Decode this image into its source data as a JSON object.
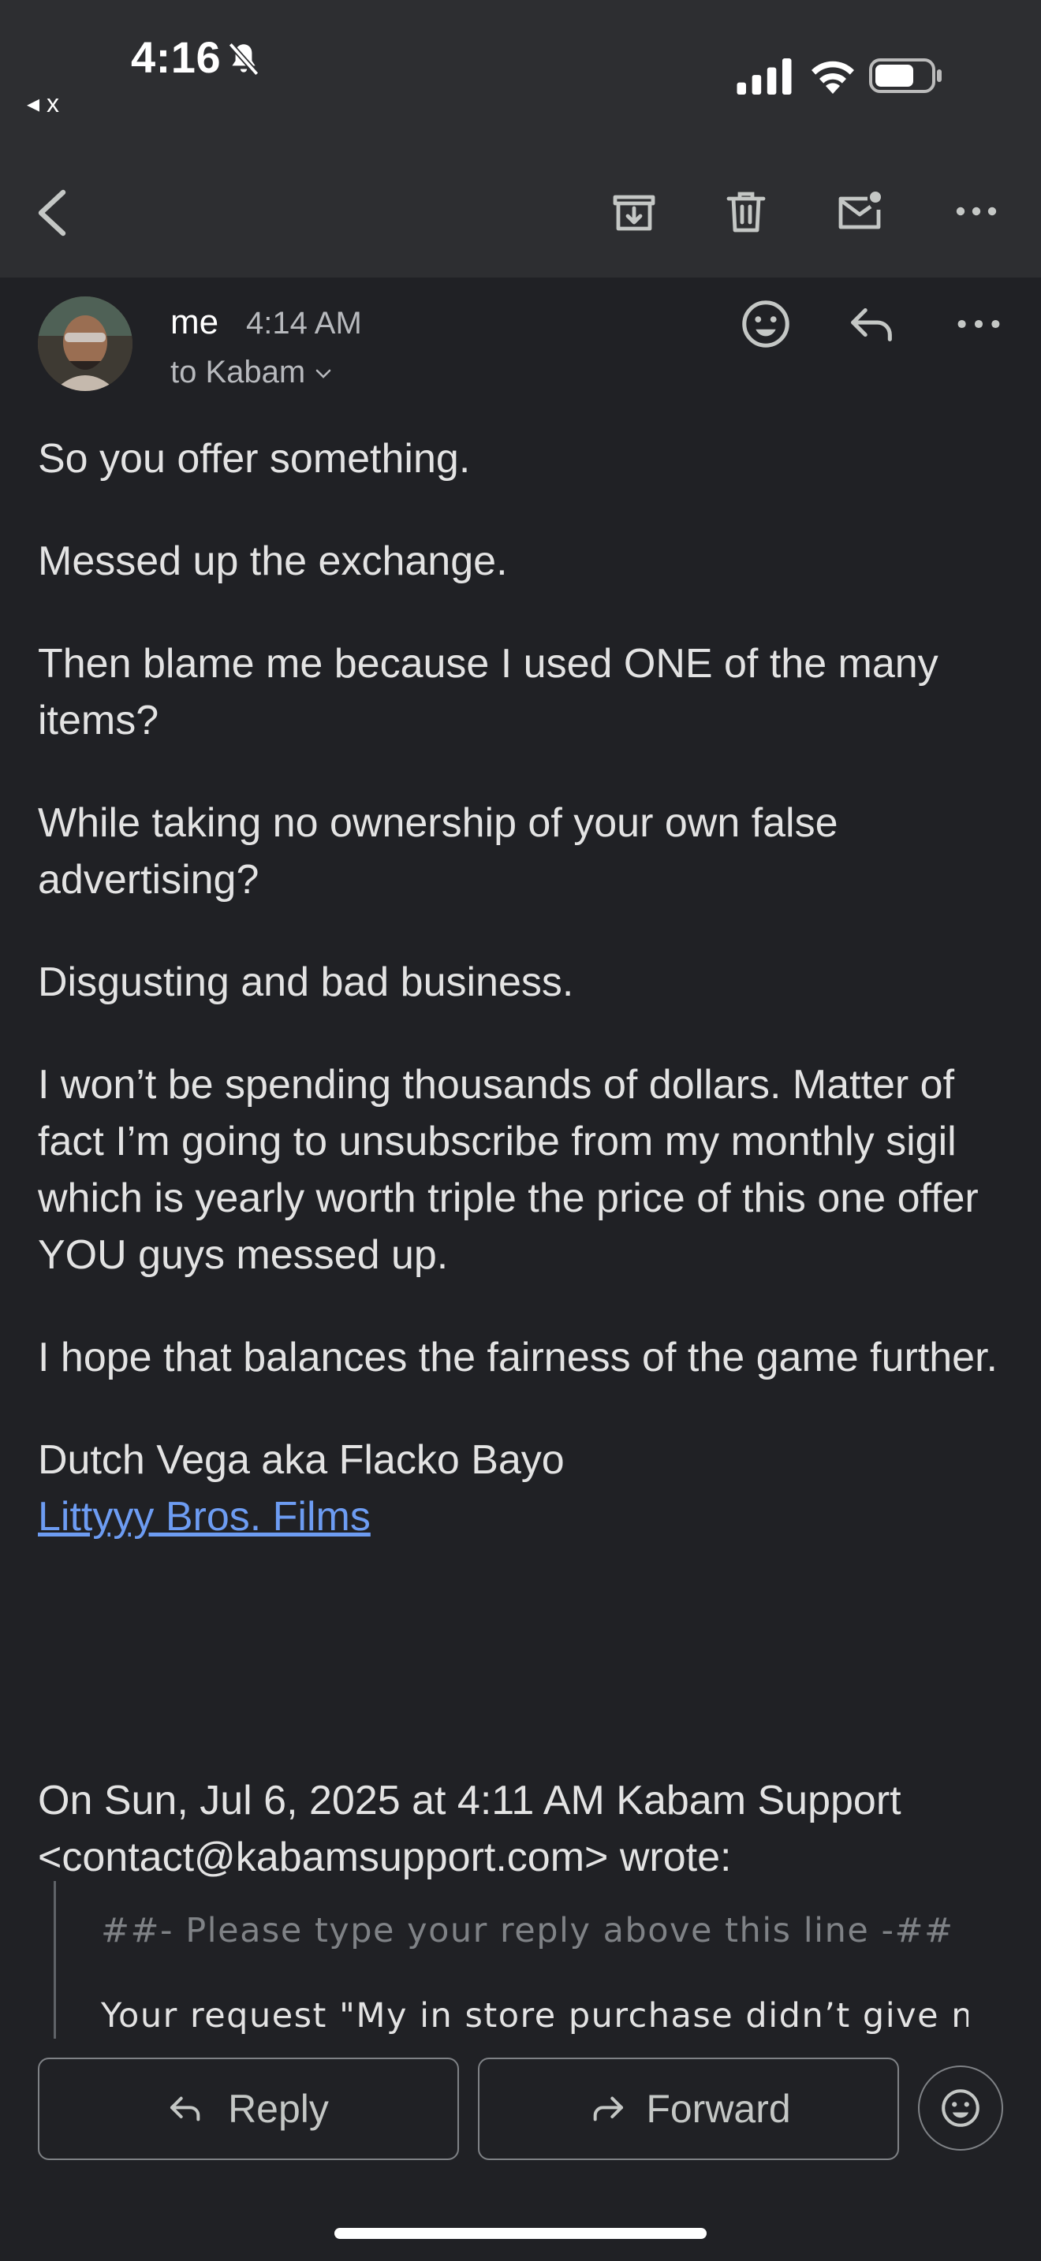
{
  "status_bar": {
    "time": "4:16",
    "back_app": "◂ x"
  },
  "toolbar": {
    "icons": [
      "back-arrow-icon",
      "archive-icon",
      "delete-icon",
      "mark-unread-icon",
      "more-icon"
    ]
  },
  "message": {
    "sender": "me",
    "time": "4:14 AM",
    "recipient": "to Kabam",
    "paragraphs": [
      "So you offer something.",
      "Messed up the exchange.",
      "Then blame me because I used ONE of the many items?",
      "While taking no ownership of your own false advertising?",
      "Disgusting and bad business.",
      "I won’t be spending thousands of dollars. Matter of fact I’m going to unsubscribe from my monthly sigil which is yearly worth triple the price of this one offer YOU guys messed up.",
      "I hope that balances the fairness of the game further."
    ],
    "signature_name": "Dutch Vega aka Flacko Bayo",
    "signature_link": "Littyyy Bros. Films",
    "quote_header": "On Sun, Jul 6, 2025 at 4:11 AM Kabam Support <contact@kabamsupport.com> wrote:",
    "quote_separator": "##- Please type your reply above this line -##",
    "quote_first_line": "Your request \"My in store purchase didn’t give me"
  },
  "actions": {
    "reply_label": "Reply",
    "forward_label": "Forward"
  },
  "colors": {
    "background": "#202125",
    "toolbar": "#2d2e31",
    "link": "#6d9cf2"
  }
}
